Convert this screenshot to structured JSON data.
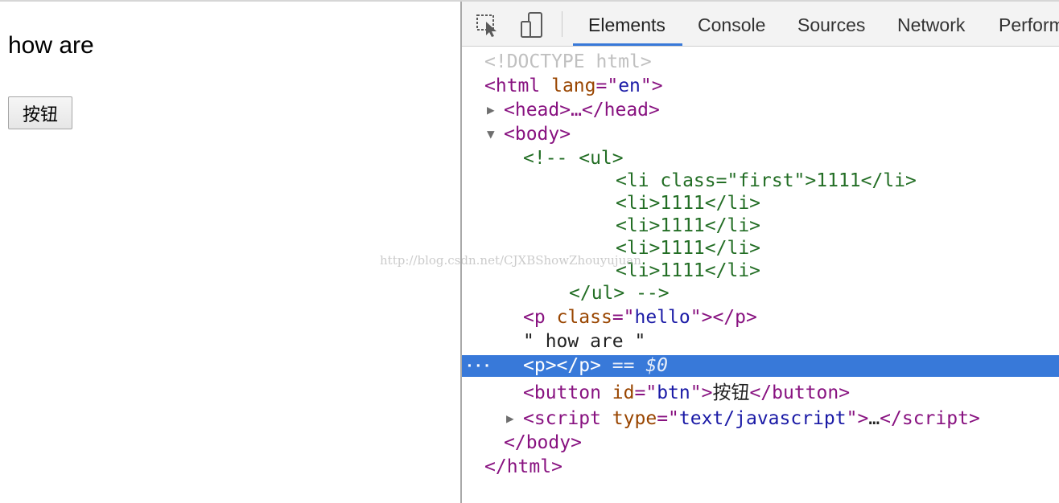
{
  "page": {
    "text": "how are",
    "button_label": "按钮"
  },
  "devtools": {
    "tabs": [
      {
        "label": "Elements",
        "active": true
      },
      {
        "label": "Console"
      },
      {
        "label": "Sources"
      },
      {
        "label": "Network"
      },
      {
        "label": "Perform"
      }
    ],
    "icons": [
      "inspect-cursor-icon",
      "device-toggle-icon"
    ],
    "accent": "#3879d9",
    "tree": {
      "doctype": "<!DOCTYPE html>",
      "html_open": "<html",
      "html_lang_attr": "lang",
      "html_lang_val": "en",
      "head_collapsed": "<head>…</head>",
      "body_open": "<body>",
      "comment_lines": [
        "<!-- <ul>",
        "<li class=\"first\">1111</li>",
        "<li>1111</li>",
        "<li>1111</li>",
        "<li>1111</li>",
        "<li>1111</li>",
        "</ul> -->"
      ],
      "p_hello_class": "hello",
      "text_node": "\" how are \"",
      "selected_marker": "== $0",
      "button_id": "btn",
      "button_text": "按钮",
      "script_type": "text/javascript",
      "ellipsis": "…",
      "body_close": "</body>",
      "html_close": "</html>"
    }
  },
  "watermark": "http://blog.csdn.net/CJXBShowZhouyujuan"
}
